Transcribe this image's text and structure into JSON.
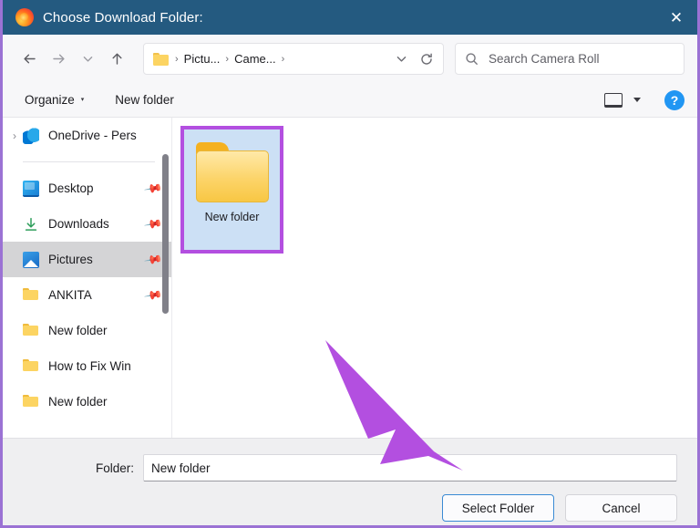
{
  "titlebar": {
    "app_icon": "firefox-logo",
    "title": "Choose Download Folder:",
    "close_label": "✕"
  },
  "navbar": {
    "back_icon": "back-arrow-icon",
    "forward_icon": "forward-arrow-icon",
    "recent_icon": "chevron-down-icon",
    "up_icon": "up-arrow-icon",
    "breadcrumb": {
      "folder_icon": "folder-icon",
      "separator": "›",
      "items": [
        "Pictu...",
        "Came..."
      ],
      "trailing_separator": "›"
    },
    "history_dropdown_icon": "chevron-down-icon",
    "refresh_icon": "refresh-icon",
    "search": {
      "icon": "search-icon",
      "value": "",
      "placeholder": "Search Camera Roll"
    }
  },
  "commandbar": {
    "organize_label": "Organize",
    "organize_caret": "▾",
    "new_folder_label": "New folder",
    "view_icon": "view-layout-icon",
    "view_caret_icon": "chevron-down-icon",
    "help_label": "?",
    "help_icon": "help-icon",
    "accent_color": "#2196f3"
  },
  "sidebar": {
    "items": [
      {
        "label": "OneDrive - Pers",
        "icon": "onedrive-icon",
        "expander": "›",
        "pinned": false,
        "selected": false
      },
      {
        "label": "Desktop",
        "icon": "desktop-icon",
        "pinned": true,
        "pin_icon": "pin-icon",
        "selected": false
      },
      {
        "label": "Downloads",
        "icon": "download-icon",
        "pinned": true,
        "pin_icon": "pin-icon",
        "selected": false
      },
      {
        "label": "Pictures",
        "icon": "pictures-icon",
        "pinned": true,
        "pin_icon": "pin-icon",
        "selected": true
      },
      {
        "label": "ANKITA",
        "icon": "folder-icon",
        "pinned": true,
        "pin_icon": "pin-icon",
        "selected": false
      },
      {
        "label": "New folder",
        "icon": "folder-icon",
        "pinned": false,
        "selected": false
      },
      {
        "label": "How to Fix Win",
        "icon": "folder-icon",
        "pinned": false,
        "selected": false
      },
      {
        "label": "New folder",
        "icon": "folder-icon",
        "pinned": false,
        "selected": false
      }
    ],
    "scrollbar": "vertical-scrollbar"
  },
  "content": {
    "items": [
      {
        "name": "New folder",
        "icon": "folder-icon",
        "selected": true,
        "highlighted": true
      }
    ],
    "selection_fill": "#cce0f5",
    "highlight_color": "#b34fe0"
  },
  "footer": {
    "folder_label": "Folder:",
    "folder_value": "New folder",
    "folder_placeholder": "",
    "select_button": "Select Folder",
    "cancel_button": "Cancel"
  },
  "annotation": {
    "arrow_color": "#b34fe0",
    "arrow_target": "select-folder-button",
    "window_border_color": "#9b72d4"
  }
}
